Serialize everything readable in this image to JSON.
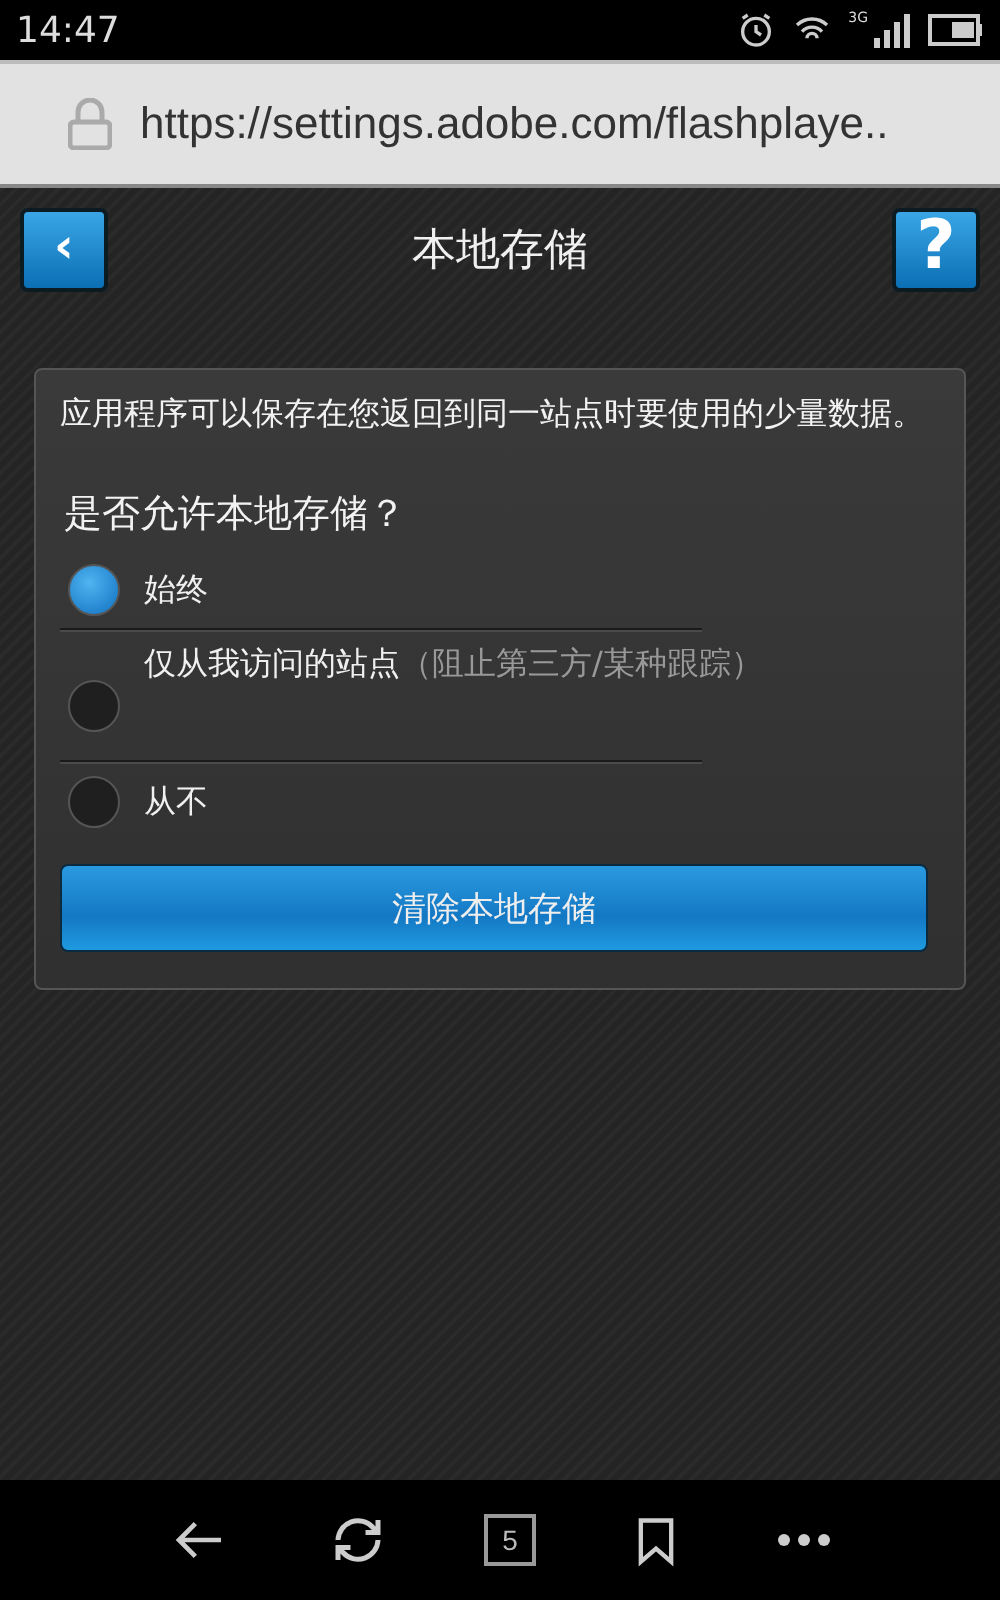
{
  "status_bar": {
    "time": "14:47",
    "network": "3G"
  },
  "address_bar": {
    "url": "https://settings.adobe.com/flashplaye.."
  },
  "header": {
    "back": "‹",
    "title": "本地存储",
    "help": "?"
  },
  "panel": {
    "description": "应用程序可以保存在您返回到同一站点时要使用的少量数据。",
    "question": "是否允许本地存储？",
    "options": [
      {
        "label": "始终",
        "selected": true
      },
      {
        "label": "仅从我访问的站点",
        "note": "（阻止第三方/某种跟踪）",
        "selected": false
      },
      {
        "label": "从不",
        "selected": false
      }
    ],
    "clear_button": "清除本地存储"
  },
  "nav_bar": {
    "tab_count": "5"
  }
}
